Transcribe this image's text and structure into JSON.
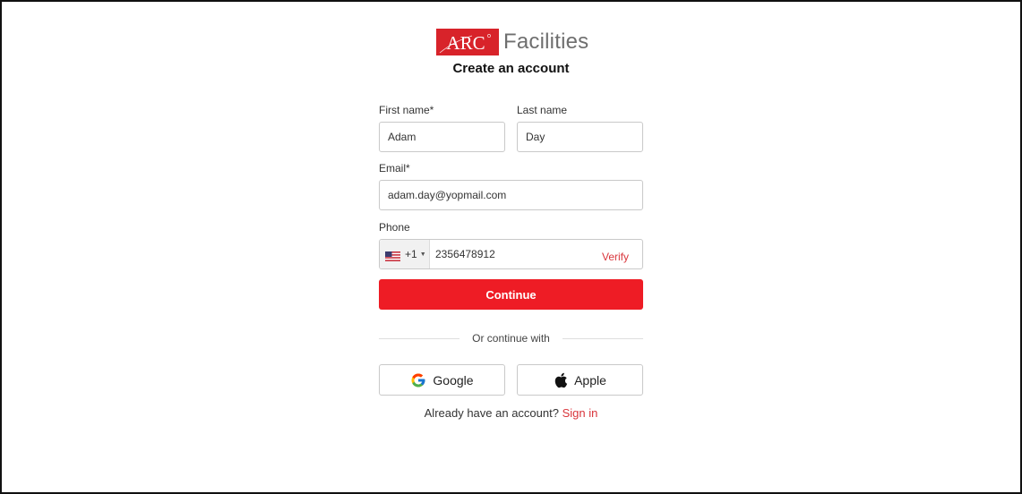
{
  "brand": {
    "logo_text": "ARC",
    "product_name": "Facilities",
    "accent_color": "#ee1c25",
    "logo_color": "#d8232a"
  },
  "form": {
    "title": "Create an account",
    "first_name": {
      "label": "First name*",
      "value": "Adam"
    },
    "last_name": {
      "label": "Last name",
      "value": "Day"
    },
    "email": {
      "label": "Email*",
      "value": "adam.day@yopmail.com"
    },
    "phone": {
      "label": "Phone",
      "country_flag": "us-flag-icon",
      "country_code": "+1",
      "value": "2356478912",
      "verify_label": "Verify"
    },
    "continue_label": "Continue"
  },
  "social": {
    "divider_text": "Or continue with",
    "google_label": "Google",
    "apple_label": "Apple"
  },
  "footer": {
    "prompt": "Already have an account?",
    "signin_label": "Sign in"
  }
}
